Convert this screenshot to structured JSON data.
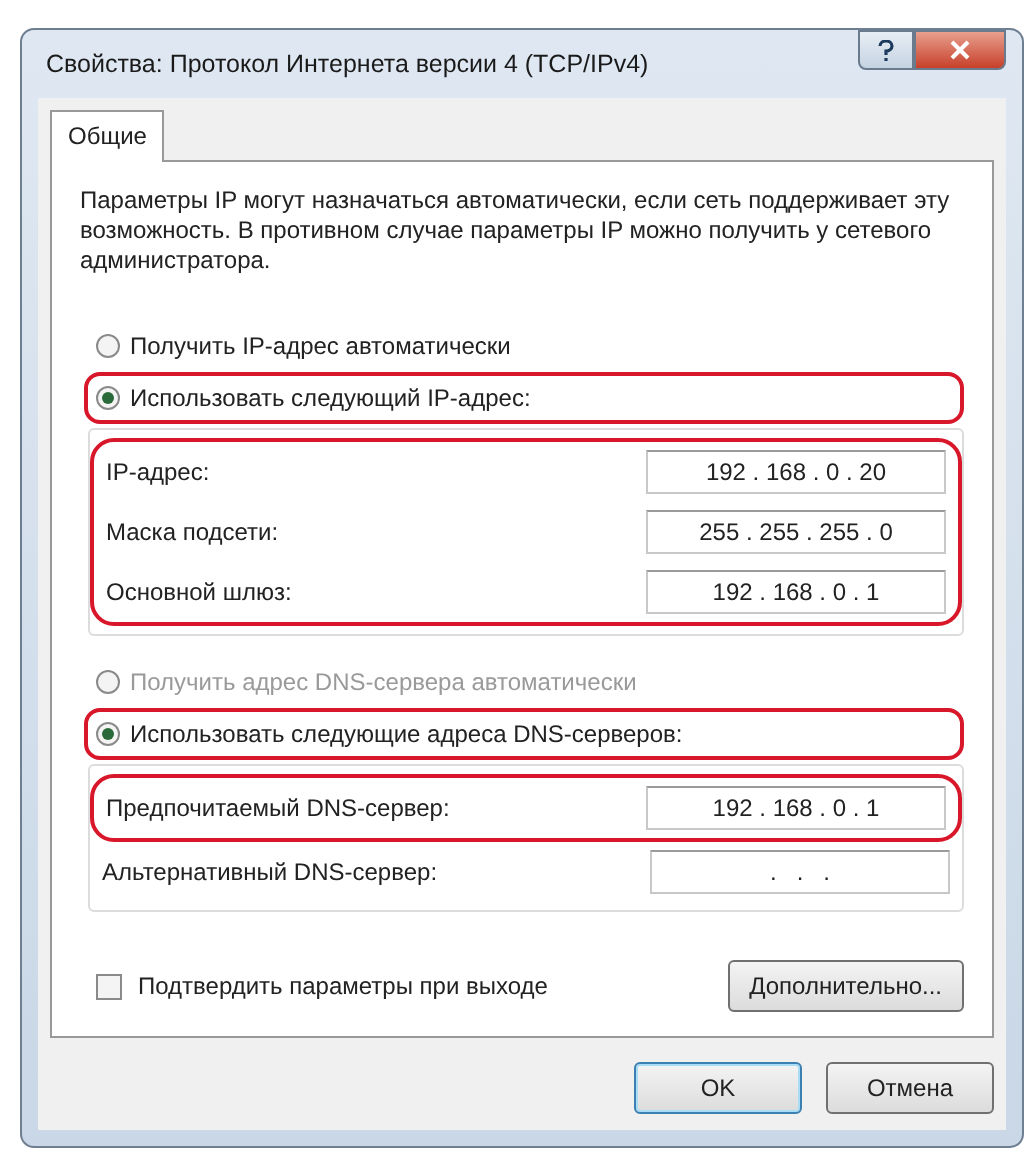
{
  "window": {
    "title": "Свойства: Протокол Интернета версии 4 (TCP/IPv4)"
  },
  "tabs": [
    {
      "label": "Общие",
      "selected": true
    }
  ],
  "description": "Параметры IP могут назначаться автоматически, если сеть поддерживает эту возможность. В противном случае параметры IP можно получить у сетевого администратора.",
  "sections": [
    {
      "radios": [
        {
          "label": "Получить IP-адрес автоматически",
          "selected": false,
          "disabled": false,
          "highlighted": false
        },
        {
          "label": "Использовать следующий IP-адрес:",
          "selected": true,
          "disabled": false,
          "highlighted": true
        }
      ],
      "fields": [
        {
          "label": "IP-адрес:",
          "value": "192 . 168 . 0 . 20",
          "highlighted": true
        },
        {
          "label": "Маска подсети:",
          "value": "255 . 255 . 255 . 0",
          "highlighted": true
        },
        {
          "label": "Основной шлюз:",
          "value": "192 . 168 . 0 . 1",
          "highlighted": true
        }
      ]
    },
    {
      "radios": [
        {
          "label": "Получить адрес DNS-сервера автоматически",
          "selected": false,
          "disabled": true,
          "highlighted": false
        },
        {
          "label": "Использовать следующие адреса DNS-серверов:",
          "selected": true,
          "disabled": false,
          "highlighted": true
        }
      ],
      "fields": [
        {
          "label": "Предпочитаемый DNS-сервер:",
          "value": "192 . 168 . 0 . 1",
          "highlighted": true
        },
        {
          "label": "Альтернативный DNS-сервер:",
          "value": ".   .   .",
          "highlighted": false
        }
      ]
    }
  ],
  "validate_checkbox": {
    "label": "Подтвердить параметры при выходе",
    "checked": false
  },
  "advanced_button": "Дополнительно...",
  "buttons": [
    {
      "label": "OK",
      "default": true
    },
    {
      "label": "Отмена",
      "default": false
    }
  ]
}
